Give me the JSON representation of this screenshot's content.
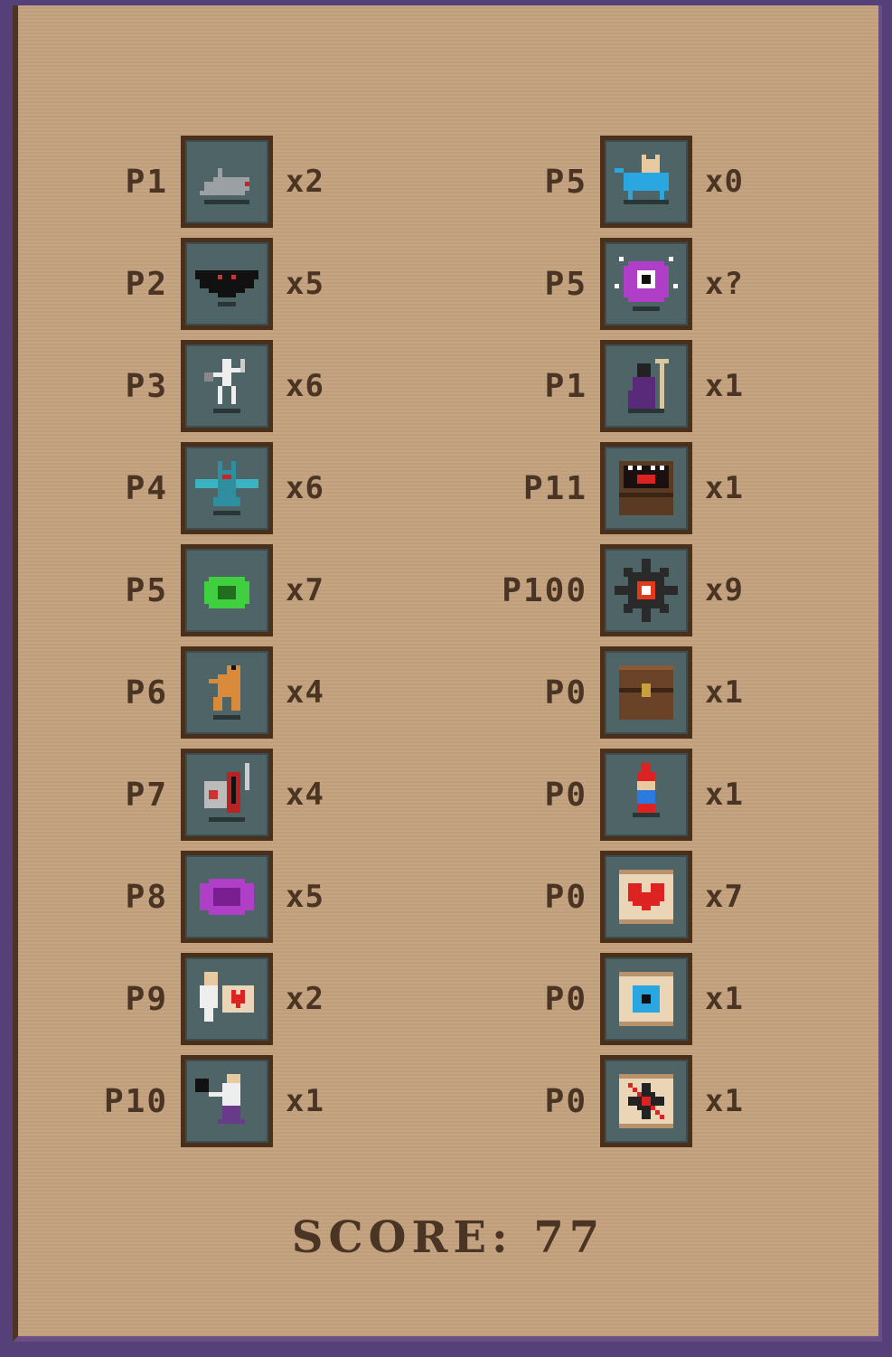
{
  "left_column": [
    {
      "points": "P1",
      "count": "x2",
      "icon": "rat-icon"
    },
    {
      "points": "P2",
      "count": "x5",
      "icon": "bat-icon"
    },
    {
      "points": "P3",
      "count": "x6",
      "icon": "skeleton-icon"
    },
    {
      "points": "P4",
      "count": "x6",
      "icon": "gargoyle-icon"
    },
    {
      "points": "P5",
      "count": "x7",
      "icon": "green-slime-icon"
    },
    {
      "points": "P6",
      "count": "x4",
      "icon": "kobold-icon"
    },
    {
      "points": "P7",
      "count": "x4",
      "icon": "knight-icon"
    },
    {
      "points": "P8",
      "count": "x5",
      "icon": "purple-slime-icon"
    },
    {
      "points": "P9",
      "count": "x2",
      "icon": "fairy-heart-icon"
    },
    {
      "points": "P10",
      "count": "x1",
      "icon": "wizard-bomb-icon"
    }
  ],
  "right_column": [
    {
      "points": "P5",
      "count": "x0",
      "icon": "blue-cat-icon"
    },
    {
      "points": "P5",
      "count": "x?",
      "icon": "beholder-icon"
    },
    {
      "points": "P1",
      "count": "x1",
      "icon": "dark-mage-icon"
    },
    {
      "points": "P11",
      "count": "x1",
      "icon": "mimic-chest-icon"
    },
    {
      "points": "P100",
      "count": "x9",
      "icon": "mine-icon"
    },
    {
      "points": "P0",
      "count": "x1",
      "icon": "treasure-chest-icon"
    },
    {
      "points": "P0",
      "count": "x1",
      "icon": "gnome-icon"
    },
    {
      "points": "P0",
      "count": "x7",
      "icon": "heart-scroll-icon"
    },
    {
      "points": "P0",
      "count": "x1",
      "icon": "eye-scroll-icon"
    },
    {
      "points": "P0",
      "count": "x1",
      "icon": "no-mine-scroll-icon"
    }
  ],
  "score": {
    "label": "SCORE:",
    "value": "77",
    "text": "SCORE: 77"
  },
  "colors": {
    "parchment": "#c4a27f",
    "tile": "#4f6466",
    "tile_border": "#4a2f1b",
    "text": "#4a3424",
    "frame": "#55407a"
  }
}
